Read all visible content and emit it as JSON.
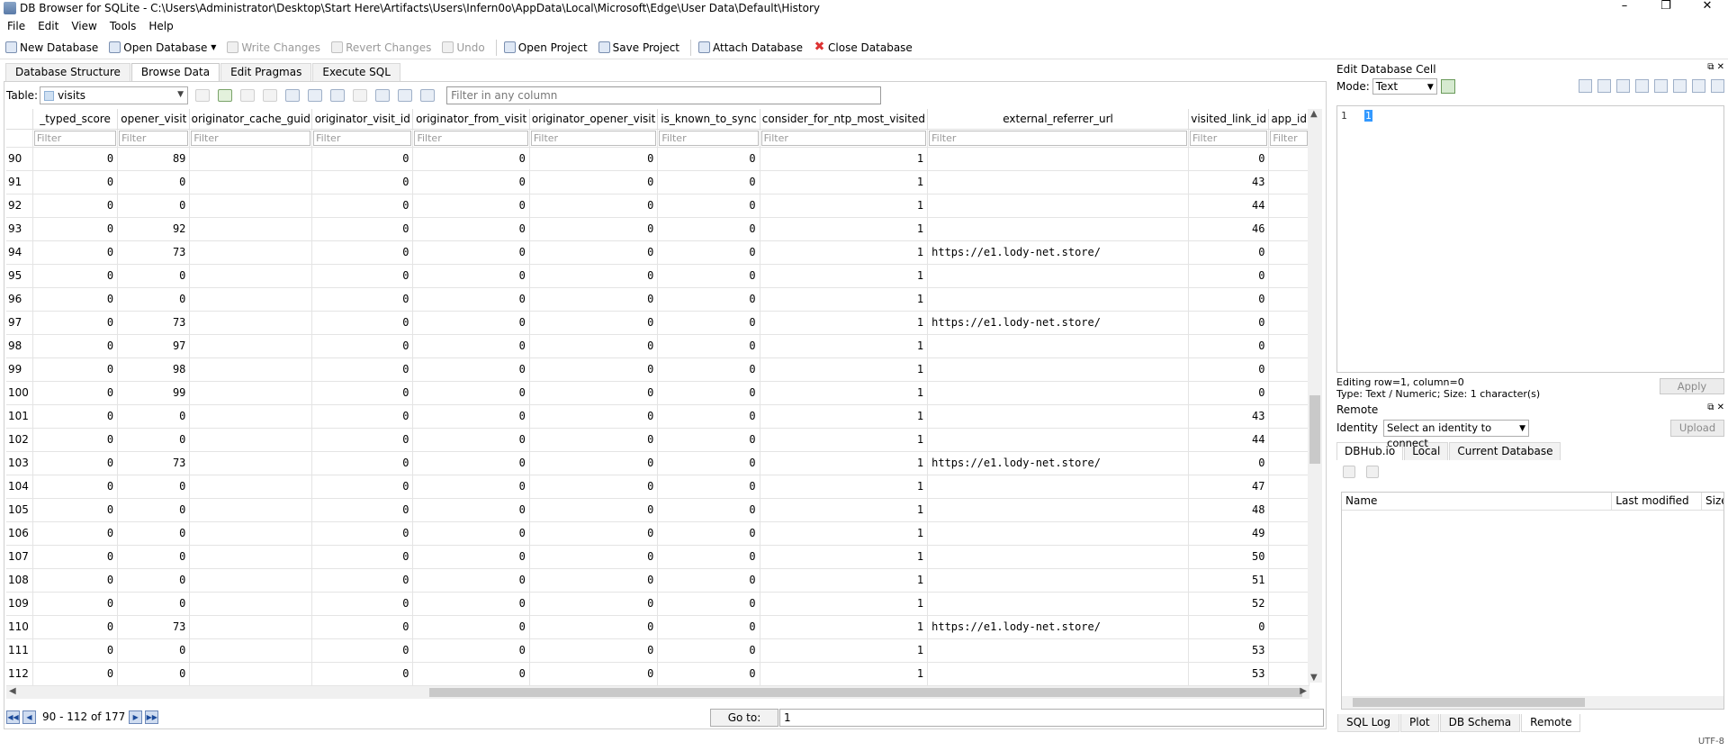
{
  "window": {
    "title": "DB Browser for SQLite - C:\\Users\\Administrator\\Desktop\\Start Here\\Artifacts\\Users\\Infern0o\\AppData\\Local\\Microsoft\\Edge\\User Data\\Default\\History",
    "minimize": "–",
    "maximize": "❐",
    "close": "✕"
  },
  "menu": [
    "File",
    "Edit",
    "View",
    "Tools",
    "Help"
  ],
  "toolbar": {
    "new_db": "New Database",
    "open_db": "Open Database",
    "write": "Write Changes",
    "revert": "Revert Changes",
    "undo": "Undo",
    "open_project": "Open Project",
    "save_project": "Save Project",
    "attach": "Attach Database",
    "close_db": "Close Database"
  },
  "tabs": [
    "Database Structure",
    "Browse Data",
    "Edit Pragmas",
    "Execute SQL"
  ],
  "browse": {
    "table_label": "Table:",
    "table_value": "visits",
    "filter_placeholder": "Filter in any column",
    "filter_cell": "Filter",
    "columns": [
      "_typed_score",
      "opener_visit",
      "originator_cache_guid",
      "originator_visit_id",
      "originator_from_visit",
      "originator_opener_visit",
      "is_known_to_sync",
      "consider_for_ntp_most_visited",
      "external_referrer_url",
      "visited_link_id",
      "app_id"
    ],
    "rows": [
      {
        "rn": "90",
        "c": [
          "0",
          "89",
          "",
          "0",
          "0",
          "0",
          "0",
          "1",
          "",
          "0",
          ""
        ]
      },
      {
        "rn": "91",
        "c": [
          "0",
          "0",
          "",
          "0",
          "0",
          "0",
          "0",
          "1",
          "",
          "43",
          ""
        ]
      },
      {
        "rn": "92",
        "c": [
          "0",
          "0",
          "",
          "0",
          "0",
          "0",
          "0",
          "1",
          "",
          "44",
          ""
        ]
      },
      {
        "rn": "93",
        "c": [
          "0",
          "92",
          "",
          "0",
          "0",
          "0",
          "0",
          "1",
          "",
          "46",
          ""
        ]
      },
      {
        "rn": "94",
        "c": [
          "0",
          "73",
          "",
          "0",
          "0",
          "0",
          "0",
          "1",
          "https://e1.lody-net.store/",
          "0",
          ""
        ]
      },
      {
        "rn": "95",
        "c": [
          "0",
          "0",
          "",
          "0",
          "0",
          "0",
          "0",
          "1",
          "",
          "0",
          ""
        ]
      },
      {
        "rn": "96",
        "c": [
          "0",
          "0",
          "",
          "0",
          "0",
          "0",
          "0",
          "1",
          "",
          "0",
          ""
        ]
      },
      {
        "rn": "97",
        "c": [
          "0",
          "73",
          "",
          "0",
          "0",
          "0",
          "0",
          "1",
          "https://e1.lody-net.store/",
          "0",
          ""
        ]
      },
      {
        "rn": "98",
        "c": [
          "0",
          "97",
          "",
          "0",
          "0",
          "0",
          "0",
          "1",
          "",
          "0",
          ""
        ]
      },
      {
        "rn": "99",
        "c": [
          "0",
          "98",
          "",
          "0",
          "0",
          "0",
          "0",
          "1",
          "",
          "0",
          ""
        ]
      },
      {
        "rn": "100",
        "c": [
          "0",
          "99",
          "",
          "0",
          "0",
          "0",
          "0",
          "1",
          "",
          "0",
          ""
        ]
      },
      {
        "rn": "101",
        "c": [
          "0",
          "0",
          "",
          "0",
          "0",
          "0",
          "0",
          "1",
          "",
          "43",
          ""
        ]
      },
      {
        "rn": "102",
        "c": [
          "0",
          "0",
          "",
          "0",
          "0",
          "0",
          "0",
          "1",
          "",
          "44",
          ""
        ]
      },
      {
        "rn": "103",
        "c": [
          "0",
          "73",
          "",
          "0",
          "0",
          "0",
          "0",
          "1",
          "https://e1.lody-net.store/",
          "0",
          ""
        ]
      },
      {
        "rn": "104",
        "c": [
          "0",
          "0",
          "",
          "0",
          "0",
          "0",
          "0",
          "1",
          "",
          "47",
          ""
        ]
      },
      {
        "rn": "105",
        "c": [
          "0",
          "0",
          "",
          "0",
          "0",
          "0",
          "0",
          "1",
          "",
          "48",
          ""
        ]
      },
      {
        "rn": "106",
        "c": [
          "0",
          "0",
          "",
          "0",
          "0",
          "0",
          "0",
          "1",
          "",
          "49",
          ""
        ]
      },
      {
        "rn": "107",
        "c": [
          "0",
          "0",
          "",
          "0",
          "0",
          "0",
          "0",
          "1",
          "",
          "50",
          ""
        ]
      },
      {
        "rn": "108",
        "c": [
          "0",
          "0",
          "",
          "0",
          "0",
          "0",
          "0",
          "1",
          "",
          "51",
          ""
        ]
      },
      {
        "rn": "109",
        "c": [
          "0",
          "0",
          "",
          "0",
          "0",
          "0",
          "0",
          "1",
          "",
          "52",
          ""
        ]
      },
      {
        "rn": "110",
        "c": [
          "0",
          "73",
          "",
          "0",
          "0",
          "0",
          "0",
          "1",
          "https://e1.lody-net.store/",
          "0",
          ""
        ]
      },
      {
        "rn": "111",
        "c": [
          "0",
          "0",
          "",
          "0",
          "0",
          "0",
          "0",
          "1",
          "",
          "53",
          ""
        ]
      },
      {
        "rn": "112",
        "c": [
          "0",
          "0",
          "",
          "0",
          "0",
          "0",
          "0",
          "1",
          "",
          "53",
          ""
        ]
      }
    ],
    "nav_info": "90 - 112 of 177",
    "goto_label": "Go to:",
    "goto_value": "1"
  },
  "edit_cell": {
    "title": "Edit Database Cell",
    "mode_label": "Mode:",
    "mode_value": "Text",
    "line_no": "1",
    "value": "1",
    "info1": "Editing row=1, column=0",
    "info2": "Type: Text / Numeric; Size: 1 character(s)",
    "apply": "Apply"
  },
  "remote": {
    "title": "Remote",
    "identity_label": "Identity",
    "identity_value": "Select an identity to connect",
    "upload": "Upload",
    "tabs": [
      "DBHub.io",
      "Local",
      "Current Database"
    ],
    "columns": [
      "Name",
      "Last modified",
      "Size"
    ]
  },
  "bottom_tabs": [
    "SQL Log",
    "Plot",
    "DB Schema",
    "Remote"
  ],
  "status": "UTF-8"
}
